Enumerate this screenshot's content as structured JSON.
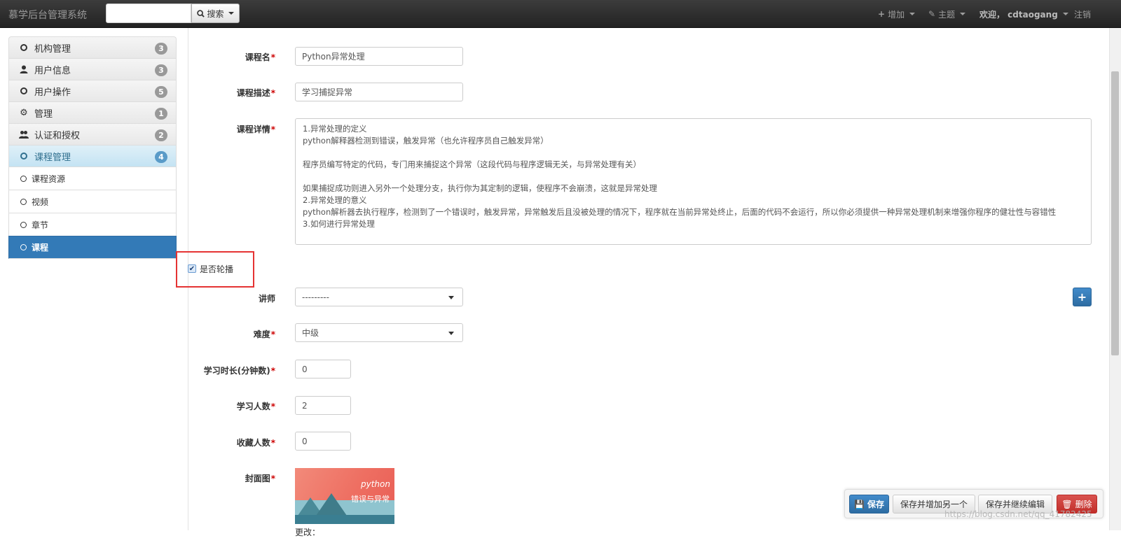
{
  "navbar": {
    "brand": "慕学后台管理系统",
    "search_placeholder": "",
    "search_label": "搜索",
    "add_label": "增加",
    "theme_label": "主题",
    "welcome_label": "欢迎， cdtaogang",
    "logout_label": "注销"
  },
  "sidebar": {
    "items": [
      {
        "label": "机构管理",
        "badge": "3",
        "icon": "circle-icon"
      },
      {
        "label": "用户信息",
        "badge": "3",
        "icon": "user-icon"
      },
      {
        "label": "用户操作",
        "badge": "5",
        "icon": "circle-icon"
      },
      {
        "label": "管理",
        "badge": "1",
        "icon": "gear-icon"
      },
      {
        "label": "认证和授权",
        "badge": "2",
        "icon": "users-icon"
      },
      {
        "label": "课程管理",
        "badge": "4",
        "icon": "circle-icon"
      }
    ],
    "sub_items": [
      {
        "label": "课程资源"
      },
      {
        "label": "视频"
      },
      {
        "label": "章节"
      },
      {
        "label": "课程"
      }
    ]
  },
  "form": {
    "name_label": "课程名",
    "name_value": "Python异常处理",
    "desc_label": "课程描述",
    "desc_value": "学习捕捉异常",
    "detail_label": "课程详情",
    "detail_lines": [
      "1.异常处理的定义",
      "python解释器检测到错误，触发异常（也允许程序员自己触发异常）",
      "",
      "程序员编写特定的代码，专门用来捕捉这个异常（这段代码与程序逻辑无关，与异常处理有关）",
      "",
      "如果捕捉成功则进入另外一个处理分支，执行你为其定制的逻辑，使程序不会崩溃，这就是异常处理",
      "2.异常处理的意义",
      "python解析器去执行程序，检测到了一个错误时，触发异常，异常触发后且没被处理的情况下，程序就在当前异常处终止，后面的代码不会运行，所以你必须提供一种异常处理机制来增强你程序的健壮性与容错性",
      "3.如何进行异常处理"
    ],
    "carousel_label": "是否轮播",
    "carousel_checked": true,
    "teacher_label": "讲师",
    "teacher_value": "---------",
    "degree_label": "难度",
    "degree_value": "中级",
    "learn_time_label": "学习时长(分钟数)",
    "learn_time_value": "0",
    "students_label": "学习人数",
    "students_value": "2",
    "fav_label": "收藏人数",
    "fav_value": "0",
    "cover_label": "封面图",
    "cover_text_brand": "python",
    "cover_text_title": "错误与异常",
    "change_label": "更改："
  },
  "actions": {
    "save": "保存",
    "save_add_another": "保存并增加另一个",
    "save_continue": "保存并继续编辑",
    "delete": "删除"
  },
  "watermark": "https://blog.csdn.net/qq_41782425",
  "colors": {
    "primary": "#337ab7",
    "danger": "#d9534f",
    "required": "#cc0000",
    "highlight_box": "#e53333"
  }
}
